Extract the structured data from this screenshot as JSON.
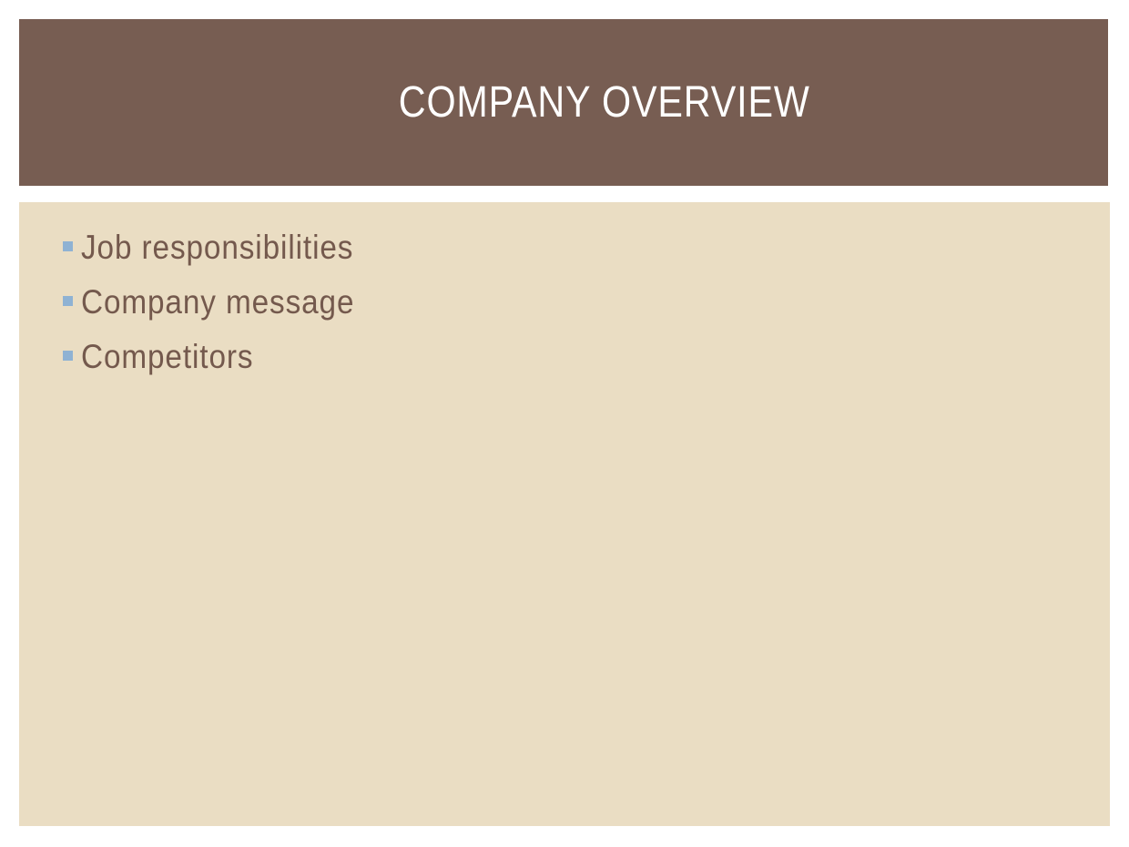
{
  "slide": {
    "title": "COMPANY OVERVIEW",
    "bullets": [
      {
        "text": "Job responsibilities"
      },
      {
        "text": "Company message"
      },
      {
        "text": "Competitors"
      }
    ]
  },
  "colors": {
    "title_band": "#775d52",
    "title_text": "#ffffff",
    "content_bg": "#eaddc3",
    "bullet_text": "#74594d",
    "bullet_marker": "#8fb2d3"
  }
}
